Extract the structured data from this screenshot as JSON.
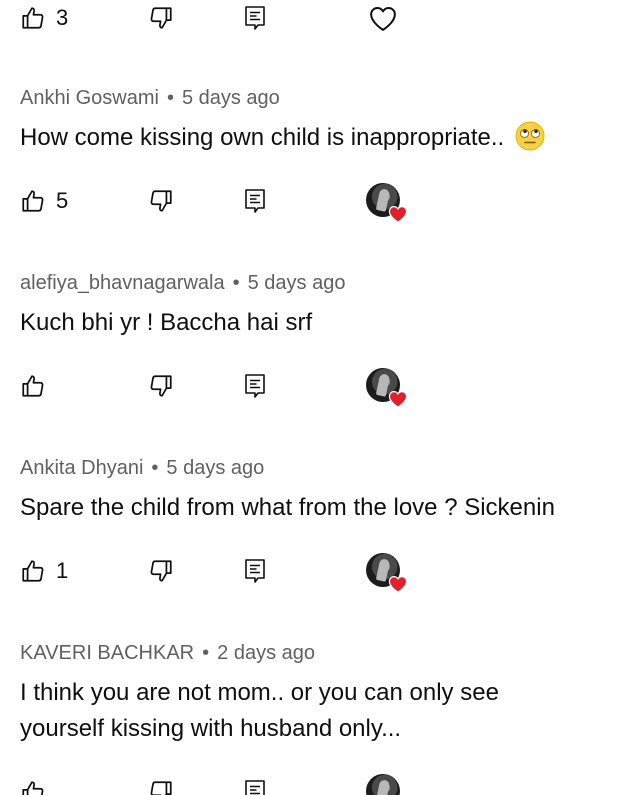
{
  "comments": [
    {
      "author": "Ankhi Goswami",
      "age": "5 days ago",
      "lines": [
        "How come kissing own child is inappropriate.."
      ],
      "emoji": "face-with-rolling-eyes-icon",
      "likes": "5",
      "creator_heart": true
    },
    {
      "author": "alefiya_bhavnagarwala",
      "age": "5 days ago",
      "lines": [
        "Kuch bhi yr ! Baccha hai srf"
      ],
      "likes": "",
      "creator_heart": true
    },
    {
      "author": "Ankita Dhyani",
      "age": "5 days ago",
      "lines": [
        "Spare the child from what from the love ? Sickenin"
      ],
      "likes": "1",
      "creator_heart": true
    },
    {
      "author": "KAVERI BACHKAR",
      "age": "2 days ago",
      "lines": [
        "I think you are not mom.. or you can only see",
        "yourself kissing with husband only..."
      ],
      "likes": "",
      "creator_heart": true
    }
  ],
  "top_row": {
    "likes": "3"
  },
  "separator": "•",
  "icons": {
    "like": "thumbs-up-icon",
    "dislike": "thumbs-down-icon",
    "reply": "reply-icon",
    "heart": "heart-icon",
    "creator_heart": "creator-heart-avatar-icon"
  },
  "colors": {
    "text": "#0f0f0f",
    "meta": "#606060",
    "heart": "#e0212d"
  }
}
